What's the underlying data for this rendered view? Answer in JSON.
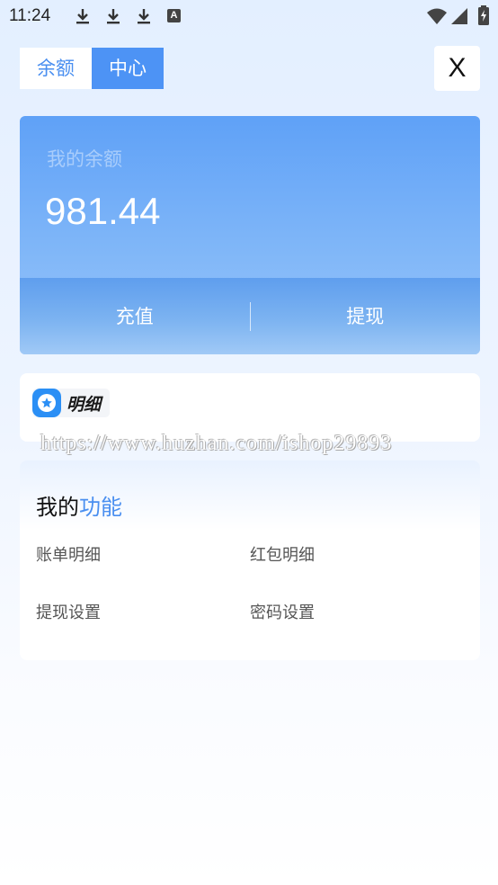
{
  "status_bar": {
    "time": "11:24",
    "icons": [
      "download-icon",
      "download-icon",
      "download-icon",
      "a-app-icon",
      "wifi-icon",
      "signal-icon",
      "battery-charging-icon"
    ],
    "a_glyph": "A"
  },
  "header": {
    "tabs": [
      {
        "label": "余额",
        "active": false
      },
      {
        "label": "中心",
        "active": true
      }
    ],
    "close_label": "X"
  },
  "balance_card": {
    "label": "我的余额",
    "amount": "981.44",
    "actions": [
      {
        "label": "充值"
      },
      {
        "label": "提现"
      }
    ]
  },
  "detail_section": {
    "label": "明细",
    "icon": "star-icon"
  },
  "watermark": "https://www.huzhan.com/ishop29893",
  "functions": {
    "title_prefix": "我的",
    "title_accent": "功能",
    "items": [
      {
        "label": "账单明细"
      },
      {
        "label": "红包明细"
      },
      {
        "label": "提现设置"
      },
      {
        "label": "密码设置"
      }
    ]
  },
  "colors": {
    "accent": "#4d93f5",
    "card_gradient_top": "#5fa1f7",
    "card_gradient_bottom": "#9ac6fb"
  }
}
